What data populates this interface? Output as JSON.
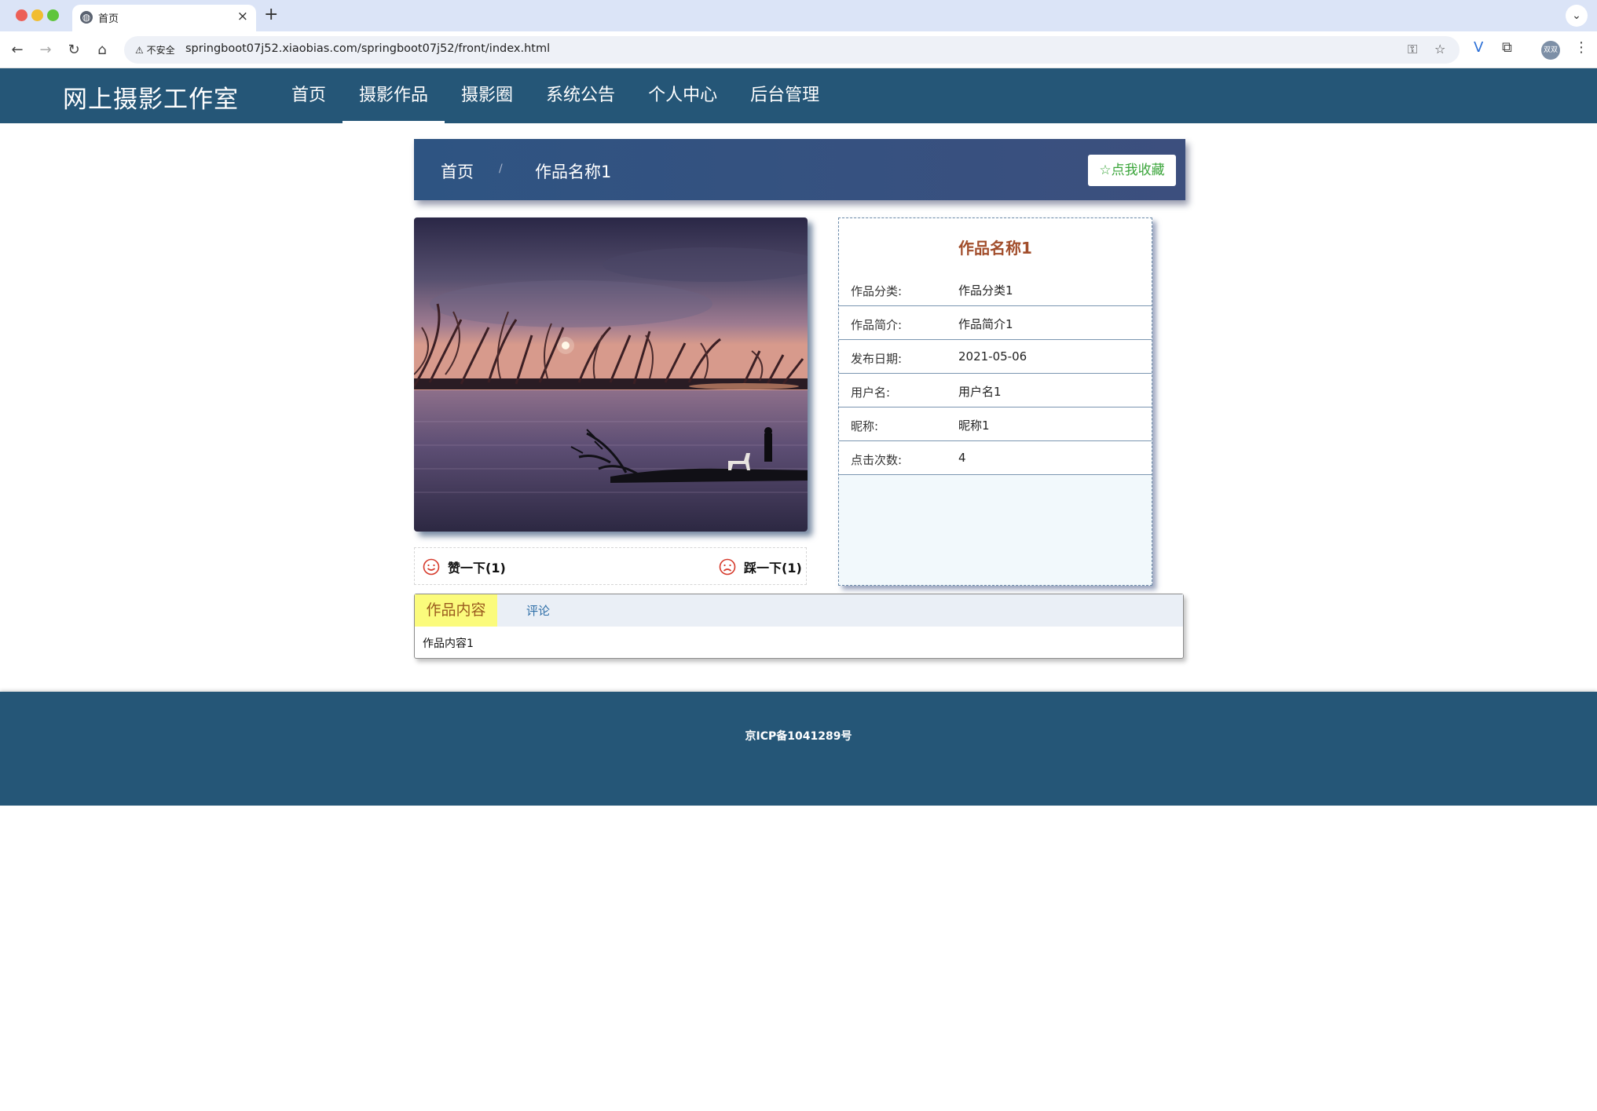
{
  "browser": {
    "tab_title": "首页",
    "insecure_label": "不安全",
    "url": "springboot07j52.xiaobias.com/springboot07j52/front/index.html",
    "avatar_text": "双双"
  },
  "site": {
    "brand": "网上摄影工作室",
    "menu": [
      "首页",
      "摄影作品",
      "摄影圈",
      "系统公告",
      "个人中心",
      "后台管理"
    ],
    "active_menu": "摄影作品"
  },
  "breadcrumb": {
    "home": "首页",
    "separator": "/",
    "current": "作品名称1",
    "favorite_label": "☆点我收藏"
  },
  "votes": {
    "like_label": "赞一下(1)",
    "dislike_label": "踩一下(1)"
  },
  "details": {
    "title": "作品名称1",
    "rows": [
      {
        "label": "作品分类:",
        "value": "作品分类1"
      },
      {
        "label": "作品简介:",
        "value": "作品简介1"
      },
      {
        "label": "发布日期:",
        "value": "2021-05-06"
      },
      {
        "label": "用户名:",
        "value": "用户名1"
      },
      {
        "label": "昵称:",
        "value": "昵称1"
      },
      {
        "label": "点击次数:",
        "value": "4"
      }
    ]
  },
  "tabs": {
    "content_tab": "作品内容",
    "comment_tab": "评论",
    "content_text": "作品内容1"
  },
  "footer": {
    "icp": "京ICP备1041289号"
  }
}
